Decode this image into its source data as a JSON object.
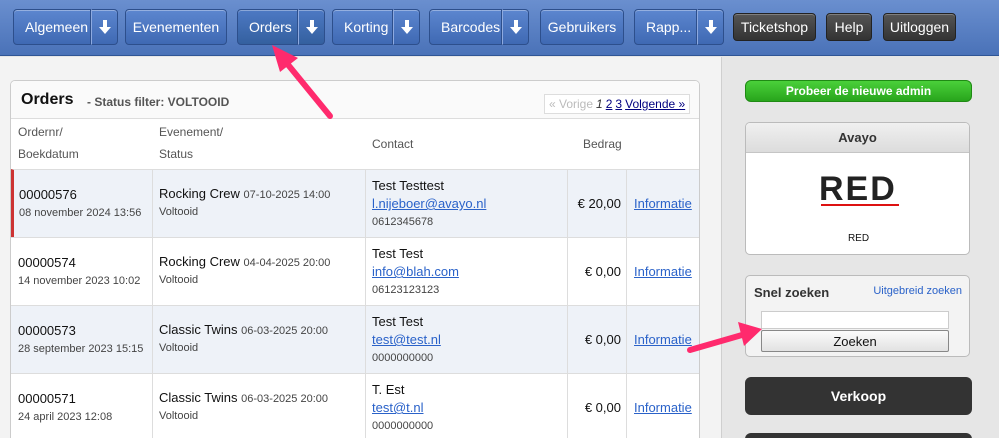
{
  "nav": {
    "items": [
      {
        "label": "Algemeen",
        "dropdown": true
      },
      {
        "label": "Evenementen",
        "dropdown": false
      },
      {
        "label": "Orders",
        "dropdown": true,
        "active": true
      },
      {
        "label": "Korting",
        "dropdown": true
      },
      {
        "label": "Barcodes",
        "dropdown": true
      },
      {
        "label": "Gebruikers",
        "dropdown": false
      },
      {
        "label": "Rapp...",
        "dropdown": true
      }
    ],
    "right_buttons": [
      "Ticketshop",
      "Help",
      "Uitloggen"
    ]
  },
  "orders": {
    "title": "Orders",
    "subtitle": "- Status filter: VOLTOOID",
    "pager": {
      "prev": "« Vorige",
      "current": "1",
      "page2": "2",
      "page3": "3",
      "next": "Volgende »"
    },
    "columns": {
      "order_line1": "Ordernr/",
      "order_line2": "Boekdatum",
      "event_line1": "Evenement/",
      "event_line2": "Status",
      "contact": "Contact",
      "amount": "Bedrag"
    },
    "rows": [
      {
        "nr": "00000576",
        "date": "08 november 2024 13:56",
        "event": "Rocking Crew",
        "event_date": "07-10-2025 14:00",
        "status": "Voltooid",
        "name": "Test Testtest",
        "email": "l.nijeboer@avayo.nl",
        "phone": "0612345678",
        "amount": "€ 20,00",
        "info": "Informatie"
      },
      {
        "nr": "00000574",
        "date": "14 november 2023 10:02",
        "event": "Rocking Crew",
        "event_date": "04-04-2025 20:00",
        "status": "Voltooid",
        "name": "Test Test",
        "email": "info@blah.com",
        "phone": "06123123123",
        "amount": "€ 0,00",
        "info": "Informatie"
      },
      {
        "nr": "00000573",
        "date": "28 september 2023 15:15",
        "event": "Classic Twins",
        "event_date": "06-03-2025 20:00",
        "status": "Voltooid",
        "name": "Test Test",
        "email": "test@test.nl",
        "phone": "0000000000",
        "amount": "€ 0,00",
        "info": "Informatie"
      },
      {
        "nr": "00000571",
        "date": "24 april 2023 12:08",
        "event": "Classic Twins",
        "event_date": "06-03-2025 20:00",
        "status": "Voltooid",
        "name": "T. Est",
        "email": "test@t.nl",
        "phone": "0000000000",
        "amount": "€ 0,00",
        "info": "Informatie"
      }
    ]
  },
  "sidebar": {
    "try_new_admin": "Probeer de nieuwe admin",
    "shop": {
      "title": "Avayo",
      "logo_text": "RED",
      "name": "RED"
    },
    "search": {
      "title": "Snel zoeken",
      "advanced": "Uitgebreid zoeken",
      "input_value": "",
      "button": "Zoeken"
    },
    "verkoop": "Verkoop"
  },
  "colors": {
    "nav": "#4a72b8",
    "link": "#2a62c9",
    "arrow": "#ff2a6d",
    "green": "#28a51c"
  }
}
